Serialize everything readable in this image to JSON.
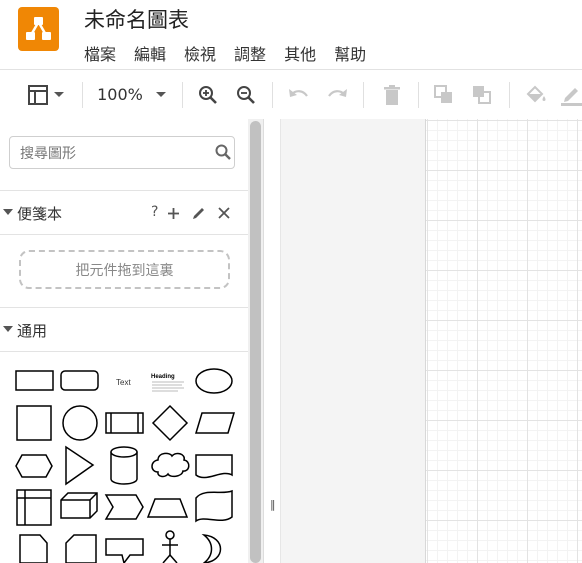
{
  "app": {
    "title": "未命名圖表",
    "menu": [
      "檔案",
      "編輯",
      "檢視",
      "調整",
      "其他",
      "幫助"
    ]
  },
  "toolbar": {
    "zoom": "100%",
    "icons": [
      "format-panel-icon",
      "dropdown-icon",
      "zoom-in-icon",
      "zoom-out-icon",
      "undo-icon",
      "redo-icon",
      "delete-icon",
      "to-front-icon",
      "to-back-icon",
      "fill-color-icon",
      "line-color-icon"
    ]
  },
  "sidebar": {
    "search_placeholder": "搜尋圖形",
    "scratchpad": {
      "title": "便箋本",
      "help": "?",
      "drop_hint": "把元件拖到這裏"
    },
    "general": {
      "title": "通用",
      "text_shape": "Text",
      "heading_shape": "Heading"
    }
  },
  "colors": {
    "brand": "#f08705"
  }
}
